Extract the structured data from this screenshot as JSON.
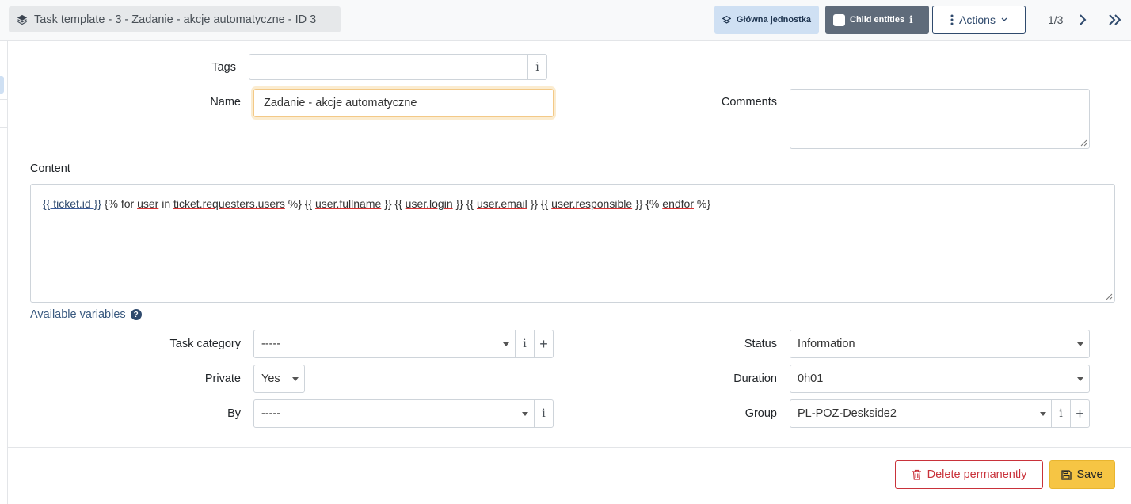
{
  "header": {
    "title": "Task template - 3 - Zadanie - akcje automatyczne - ID 3",
    "entity_button": "Główna jednostka",
    "child_entities": "Child entities",
    "actions": "Actions",
    "pager": "1/3"
  },
  "form": {
    "tags": {
      "label": "Tags",
      "value": ""
    },
    "name": {
      "label": "Name",
      "value": "Zadanie - akcje automatyczne"
    },
    "comments": {
      "label": "Comments",
      "value": ""
    },
    "content": {
      "label": "Content",
      "parts": [
        "{{ ticket.id }}",
        " {% for ",
        "user",
        " in ",
        "ticket.requesters.users",
        " %} {{ ",
        "user.fullname",
        " }} {{ ",
        "user.login",
        " }} {{ ",
        "user.email",
        " }} {{ ",
        "user.responsible",
        " }} {% ",
        "endfor",
        " %}"
      ]
    },
    "available_variables": "Available variables",
    "task_category": {
      "label": "Task category",
      "value": "-----"
    },
    "status": {
      "label": "Status",
      "value": "Information"
    },
    "private": {
      "label": "Private",
      "value": "Yes"
    },
    "duration": {
      "label": "Duration",
      "value": "0h01"
    },
    "by": {
      "label": "By",
      "value": "-----"
    },
    "group": {
      "label": "Group",
      "value": "PL-POZ-Deskside2"
    }
  },
  "footer": {
    "delete": "Delete permanently",
    "save": "Save"
  }
}
